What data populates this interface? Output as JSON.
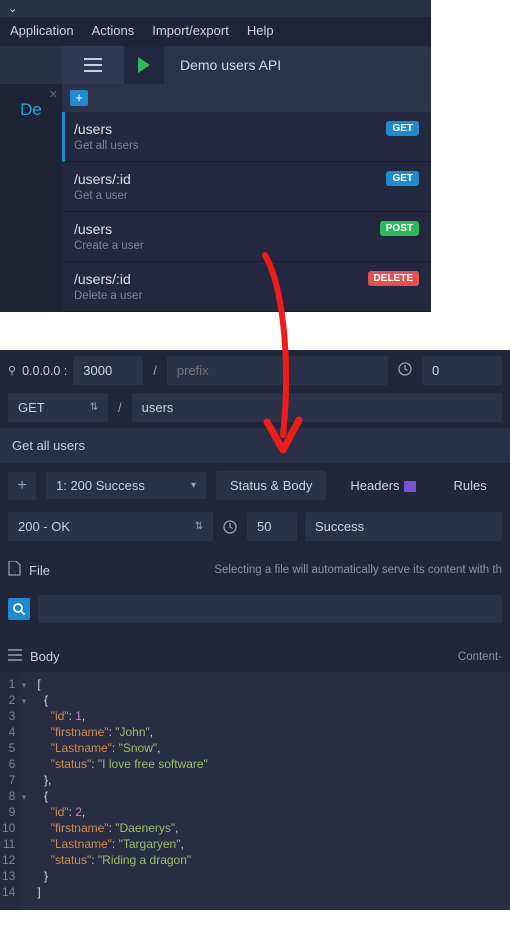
{
  "menubar": {
    "app": "Application",
    "actions": "Actions",
    "import": "Import/export",
    "help": "Help"
  },
  "api_title": "Demo users API",
  "side_tab": "De",
  "routes": [
    {
      "path": "/users",
      "desc": "Get all users",
      "method": "GET",
      "method_class": "m-get",
      "active": true
    },
    {
      "path": "/users/:id",
      "desc": "Get a user",
      "method": "GET",
      "method_class": "m-get",
      "active": false
    },
    {
      "path": "/users",
      "desc": "Create a user",
      "method": "POST",
      "method_class": "m-post",
      "active": false
    },
    {
      "path": "/users/:id",
      "desc": "Delete a user",
      "method": "DELETE",
      "method_class": "m-delete",
      "active": false
    }
  ],
  "server": {
    "host": "0.0.0.0 :",
    "port": "3000",
    "prefix_placeholder": "prefix",
    "latency": "0"
  },
  "endpoint": {
    "method": "GET",
    "path": "users",
    "doc": "Get all users"
  },
  "response_picker": "1: 200  Success",
  "tabs": {
    "status_body": "Status & Body",
    "headers": "Headers",
    "rules": "Rules"
  },
  "status": {
    "code": "200 - OK",
    "latency": "50",
    "label": "Success"
  },
  "file": {
    "label": "File",
    "hint": "Selecting a file will automatically serve its content with th"
  },
  "body": {
    "label": "Body",
    "content_label": "Content-"
  },
  "code_lines": [
    "[",
    "  {",
    "    \"id\": 1,",
    "    \"firstname\": \"John\",",
    "    \"Lastname\": \"Snow\",",
    "    \"status\": \"I love free software\"",
    "  },",
    "  {",
    "    \"id\": 2,",
    "    \"firstname\": \"Daenerys\",",
    "    \"Lastname\": \"Targaryen\",",
    "    \"status\": \"Riding a dragon\"",
    "  }",
    "]"
  ]
}
